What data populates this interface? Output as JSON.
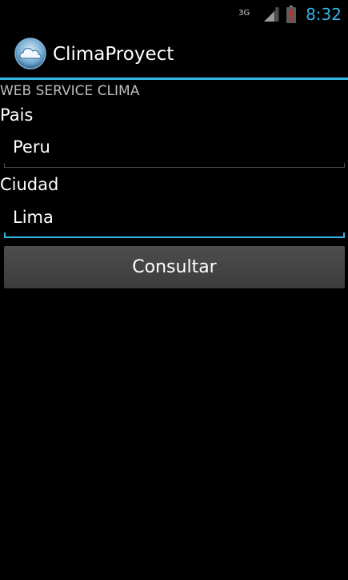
{
  "status_bar": {
    "network_type": "3G",
    "time": "8:32",
    "signal_icon": "signal-icon",
    "battery_icon": "battery-alert-icon"
  },
  "action_bar": {
    "app_icon": "cloud-icon",
    "title": "ClimaProyect"
  },
  "content": {
    "section_header": "WEB SERVICE CLIMA",
    "pais_label": "Pais",
    "pais_value": "Peru",
    "ciudad_label": "Ciudad",
    "ciudad_value": "Lima",
    "button_label": "Consultar"
  },
  "colors": {
    "accent": "#33b5e5",
    "background": "#000000",
    "button": "#444444"
  }
}
